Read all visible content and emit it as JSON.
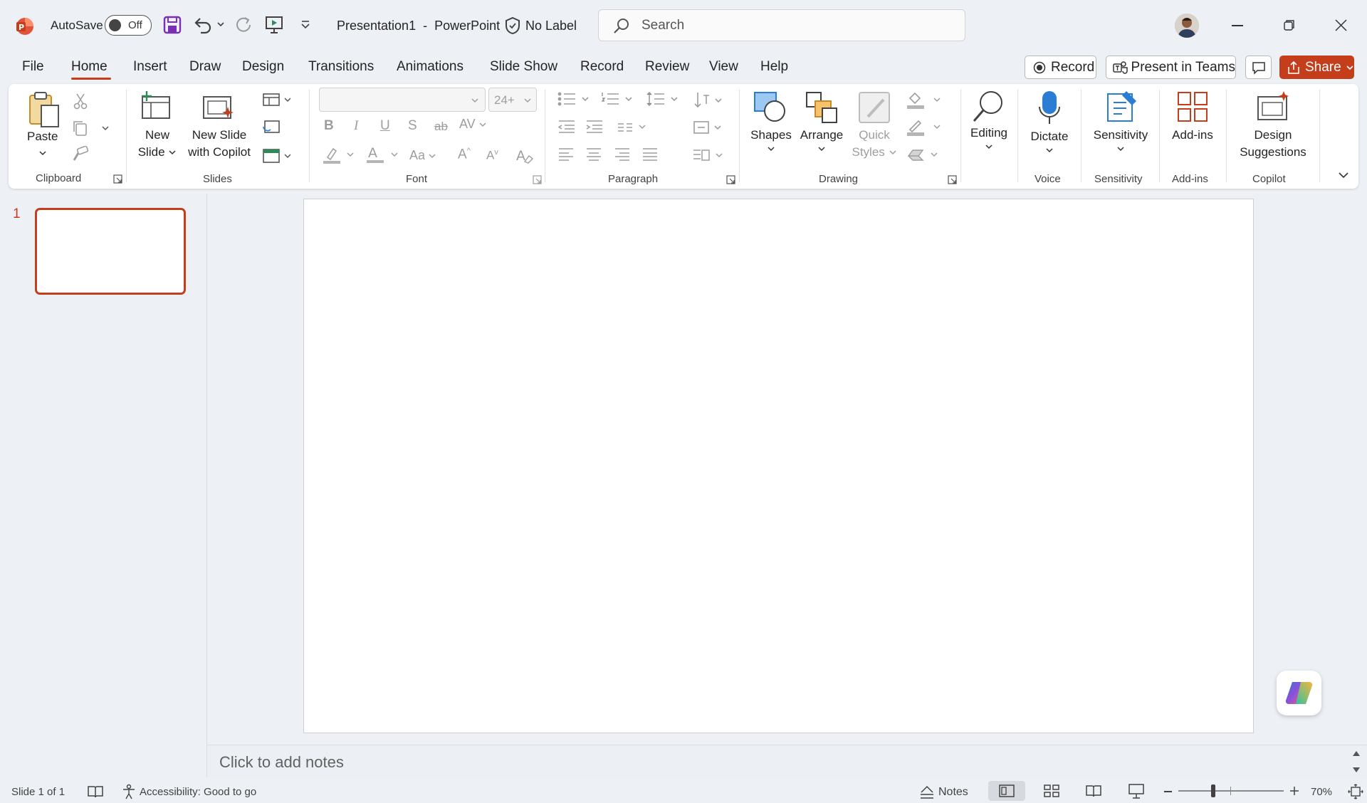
{
  "titlebar": {
    "autosave_label": "AutoSave",
    "autosave_state": "Off",
    "doc_title": "Presentation1",
    "title_sep": "-",
    "app_name": "PowerPoint",
    "label_status": "No Label",
    "search_placeholder": "Search"
  },
  "tabs": [
    {
      "label": "File"
    },
    {
      "label": "Home"
    },
    {
      "label": "Insert"
    },
    {
      "label": "Draw"
    },
    {
      "label": "Design"
    },
    {
      "label": "Transitions"
    },
    {
      "label": "Animations"
    },
    {
      "label": "Slide Show"
    },
    {
      "label": "Record"
    },
    {
      "label": "Review"
    },
    {
      "label": "View"
    },
    {
      "label": "Help"
    }
  ],
  "actions": {
    "record": "Record",
    "present_teams": "Present in Teams",
    "share": "Share"
  },
  "ribbon": {
    "clipboard": {
      "label": "Clipboard",
      "paste": "Paste"
    },
    "slides": {
      "label": "Slides",
      "new_slide_1": "New",
      "new_slide_2": "Slide",
      "copilot_1": "New Slide",
      "copilot_2": "with Copilot"
    },
    "font": {
      "label": "Font",
      "size": "24+"
    },
    "paragraph": {
      "label": "Paragraph"
    },
    "drawing": {
      "label": "Drawing",
      "shapes": "Shapes",
      "arrange": "Arrange",
      "quick_1": "Quick",
      "quick_2": "Styles"
    },
    "editing": {
      "label": "Editing"
    },
    "voice": {
      "label": "Voice",
      "dictate": "Dictate"
    },
    "sensitivity": {
      "label": "Sensitivity",
      "button": "Sensitivity"
    },
    "addins": {
      "label": "Add-ins",
      "button": "Add-ins"
    },
    "copilot": {
      "label": "Copilot",
      "design_1": "Design",
      "design_2": "Suggestions"
    }
  },
  "slides_pane": {
    "slide_number": "1"
  },
  "notes": {
    "placeholder": "Click to add notes"
  },
  "status": {
    "slide_info": "Slide 1 of 1",
    "accessibility": "Accessibility: Good to go",
    "notes": "Notes",
    "zoom": "70%",
    "zoom_value": 0.7
  },
  "colors": {
    "accent": "#c43e1c",
    "save_purple": "#7b2fb5",
    "blue": "#2b7cd3",
    "bg": "#edf0f5"
  }
}
